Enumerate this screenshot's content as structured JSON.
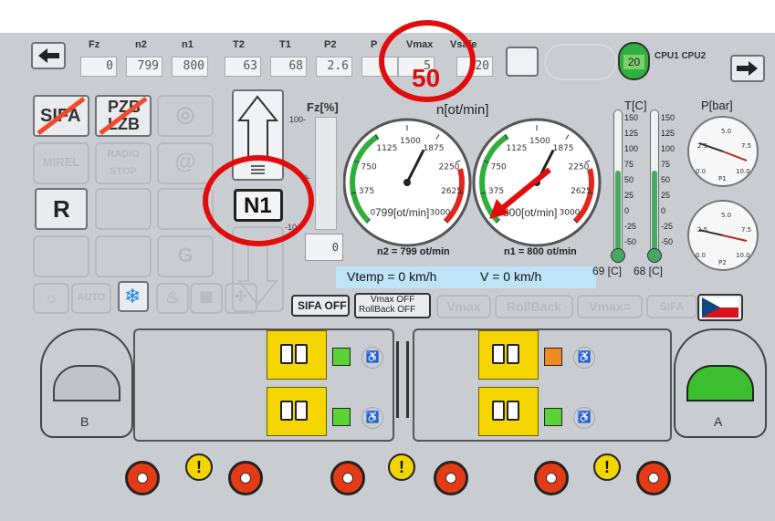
{
  "top_bar": {
    "labels": [
      "Fz",
      "n2",
      "n1",
      "T2",
      "T1",
      "P2",
      "P",
      "Vmax",
      "Vsafe"
    ],
    "values": [
      "0",
      "799",
      "800",
      "63",
      "68",
      "2.6",
      "",
      "5",
      "20"
    ],
    "speed_indicator": "20",
    "cpu_labels": "CPU1 CPU2",
    "nav_left_icon": "arrow-left-icon",
    "nav_right_icon": "arrow-right-icon"
  },
  "annotation": {
    "vmax_callout": "50"
  },
  "left_panel": {
    "sifa_label": "SIFA",
    "pzb_line1": "PZB",
    "pzb_line2": "LZB",
    "mirel_label": "MIREL",
    "radio_label": "RADIO STOP",
    "r_label": "R",
    "auto_label": "AUTO"
  },
  "direction": {
    "gear_label": "N1"
  },
  "force_gauge": {
    "title": "Fz[%]",
    "tick_top": "100-",
    "tick_mid": "0-",
    "tick_bottom": "-10",
    "value": "0"
  },
  "rpm": {
    "title": "n[ot/min]",
    "scale": [
      "0",
      "375",
      "750",
      "1125",
      "1500",
      "1875",
      "2250",
      "2625",
      "3000"
    ],
    "gauge1_value": "799[ot/min]",
    "gauge2_value": "800[ot/min]",
    "n2_text": "n2 = 799 ot/min",
    "n1_text": "n1 = 800 ot/min",
    "n2": 799,
    "n1": 800,
    "max": 3000
  },
  "speed_readouts": {
    "vtemp": "Vtemp = 0 km/h",
    "v": "V = 0 km/h"
  },
  "temperature": {
    "title": "T[C]",
    "scale": [
      "150",
      "125",
      "100",
      "75",
      "50",
      "25",
      "0",
      "-25",
      "-50"
    ],
    "t1_value": "69 [C]",
    "t2_value": "68 [C]",
    "t1": 69,
    "t2": 68,
    "min": -50,
    "max": 150
  },
  "pressure": {
    "title": "P[bar]",
    "gauge1_label": "P1",
    "gauge2_label": "P2",
    "scale": [
      "0.0",
      "2.5",
      "5.0",
      "7.5",
      "10.0"
    ]
  },
  "control_buttons": {
    "sifa_off": "SIFA OFF",
    "vmax_off_line1": "Vmax OFF",
    "vmax_off_line2": "RollBack OFF",
    "vmax_ghost": "Vmax",
    "rollback_ghost": "RollBack",
    "vmax_eq_ghost": "Vmax=",
    "sifa_ghost": "SIFA"
  },
  "cabs": {
    "left_label": "B",
    "right_label": "A"
  },
  "wheels": {
    "warning_symbol": "!"
  },
  "colors": {
    "screen_bg": "#c9cdd2",
    "door_yellow": "#f5d600",
    "gauge_green": "#2fae3c",
    "gauge_red": "#e32619",
    "callout_red": "#e10d0d",
    "wheel_red": "#e43b16",
    "status_blue": "#bfe4f7"
  }
}
